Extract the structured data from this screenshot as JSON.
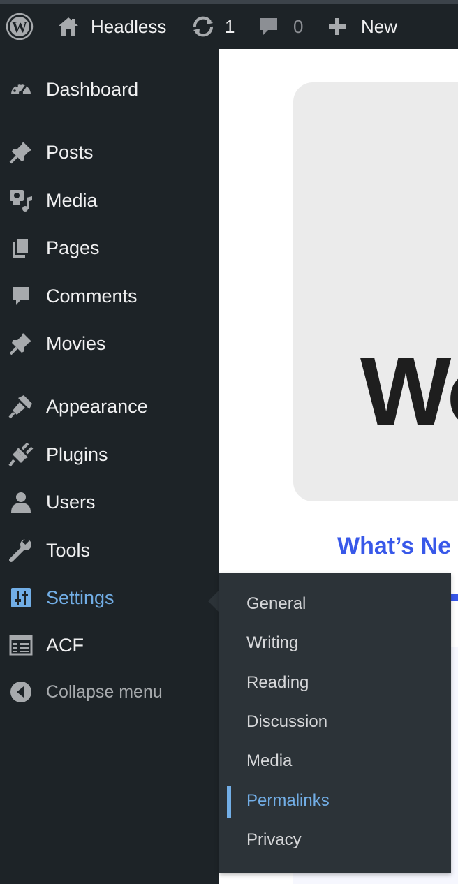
{
  "adminbar": {
    "site_name": "Headless",
    "updates_count": "1",
    "comments_count": "0",
    "new_label": "New",
    "icons": [
      "wordpress-logo-icon",
      "home-icon",
      "updates-icon",
      "comment-bubble-icon",
      "plus-icon"
    ]
  },
  "menu": {
    "items": [
      {
        "label": "Dashboard",
        "icon": "dashboard-icon"
      },
      {
        "label": "Posts",
        "icon": "pushpin-icon"
      },
      {
        "label": "Media",
        "icon": "media-icon"
      },
      {
        "label": "Pages",
        "icon": "pages-icon"
      },
      {
        "label": "Comments",
        "icon": "comment-icon"
      },
      {
        "label": "Movies",
        "icon": "pushpin-icon"
      },
      {
        "label": "Appearance",
        "icon": "paintbrush-icon"
      },
      {
        "label": "Plugins",
        "icon": "plug-icon"
      },
      {
        "label": "Users",
        "icon": "user-icon"
      },
      {
        "label": "Tools",
        "icon": "wrench-icon"
      },
      {
        "label": "Settings",
        "icon": "sliders-icon",
        "current": true
      },
      {
        "label": "ACF",
        "icon": "acf-table-icon"
      }
    ],
    "collapse_label": "Collapse menu"
  },
  "settings_submenu": {
    "items": [
      "General",
      "Writing",
      "Reading",
      "Discussion",
      "Media",
      "Permalinks",
      "Privacy"
    ],
    "current": "Permalinks"
  },
  "main": {
    "welcome_title_fragment": "Wo",
    "whats_new_fragment": "What’s Ne"
  },
  "colors": {
    "adminbar_bg": "#1d2327",
    "menu_bg": "#1d2327",
    "submenu_bg": "#2c3338",
    "current_accent": "#72aee6",
    "link_blue": "#3858e9"
  }
}
